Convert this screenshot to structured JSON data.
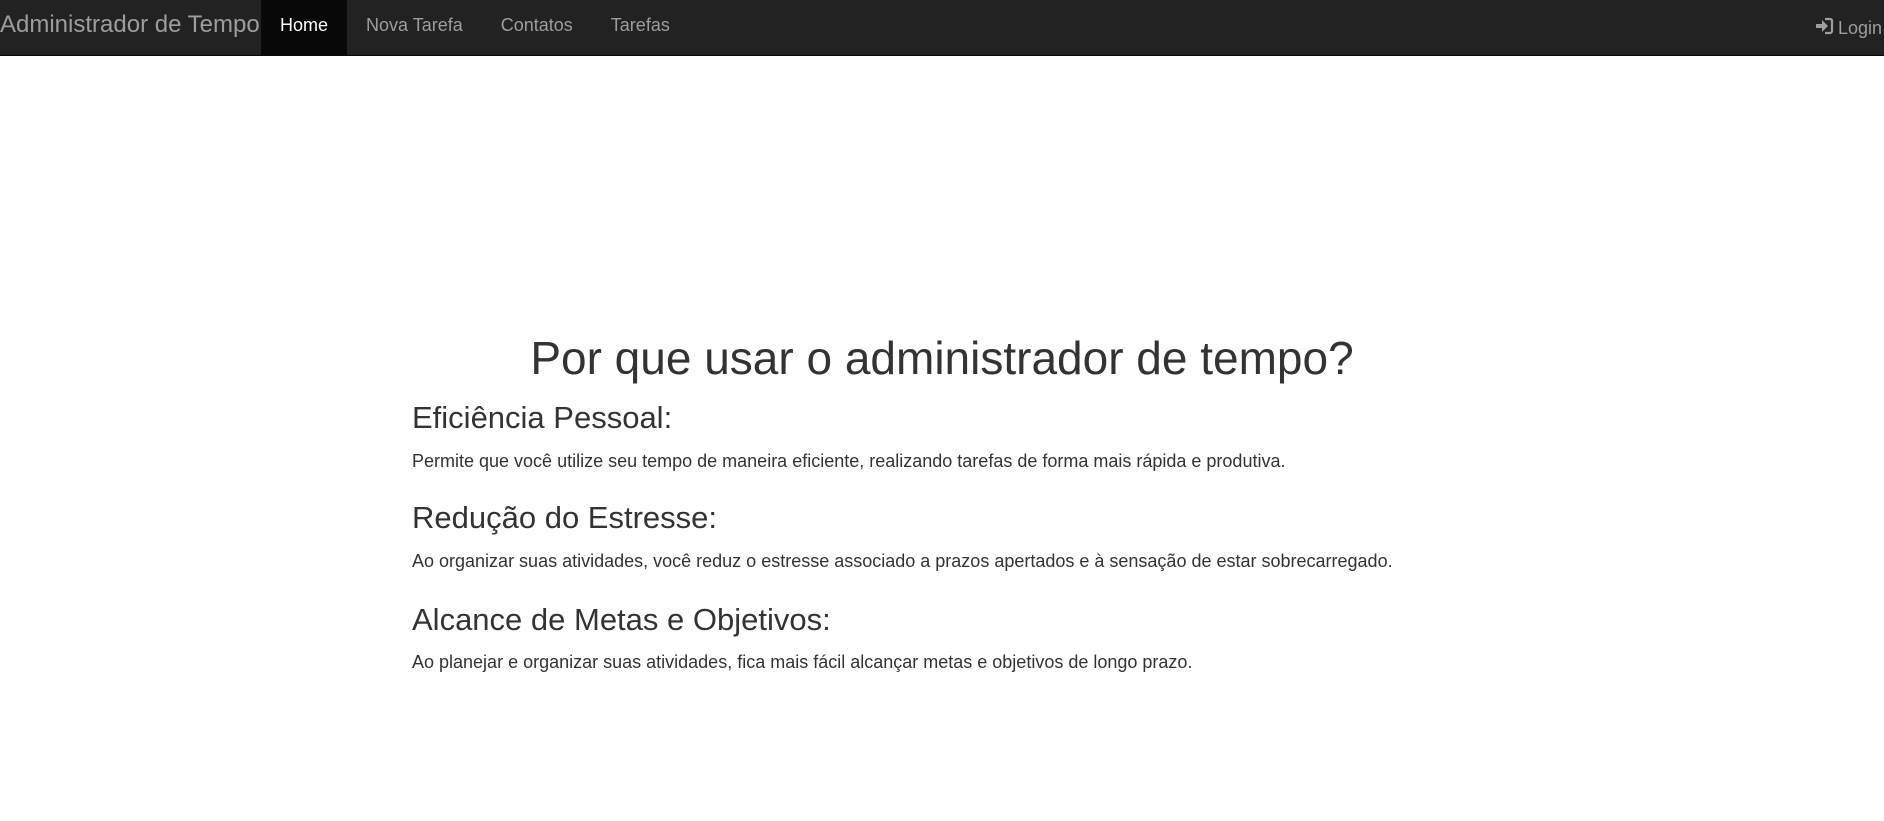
{
  "navbar": {
    "brand": "Administrador de Tempo",
    "items": [
      {
        "label": "Home",
        "active": true
      },
      {
        "label": "Nova Tarefa",
        "active": false
      },
      {
        "label": "Contatos",
        "active": false
      },
      {
        "label": "Tarefas",
        "active": false
      }
    ],
    "login_label": "Login",
    "login_icon": "login-icon"
  },
  "main": {
    "title": "Por que usar o administrador de tempo?",
    "sections": [
      {
        "title": "Eficiência Pessoal:",
        "text": "Permite que você utilize seu tempo de maneira eficiente, realizando tarefas de forma mais rápida e produtiva."
      },
      {
        "title": "Redução do Estresse:",
        "text": "Ao organizar suas atividades, você reduz o estresse associado a prazos apertados e à sensação de estar sobrecarregado."
      },
      {
        "title": "Alcance de Metas e Objetivos:",
        "text": "Ao planejar e organizar suas atividades, fica mais fácil alcançar metas e objetivos de longo prazo."
      }
    ]
  },
  "colors": {
    "navbar_bg": "#222222",
    "active_bg": "#080808",
    "nav_text": "#9d9d9d",
    "active_text": "#ffffff",
    "body_text": "#333333"
  }
}
